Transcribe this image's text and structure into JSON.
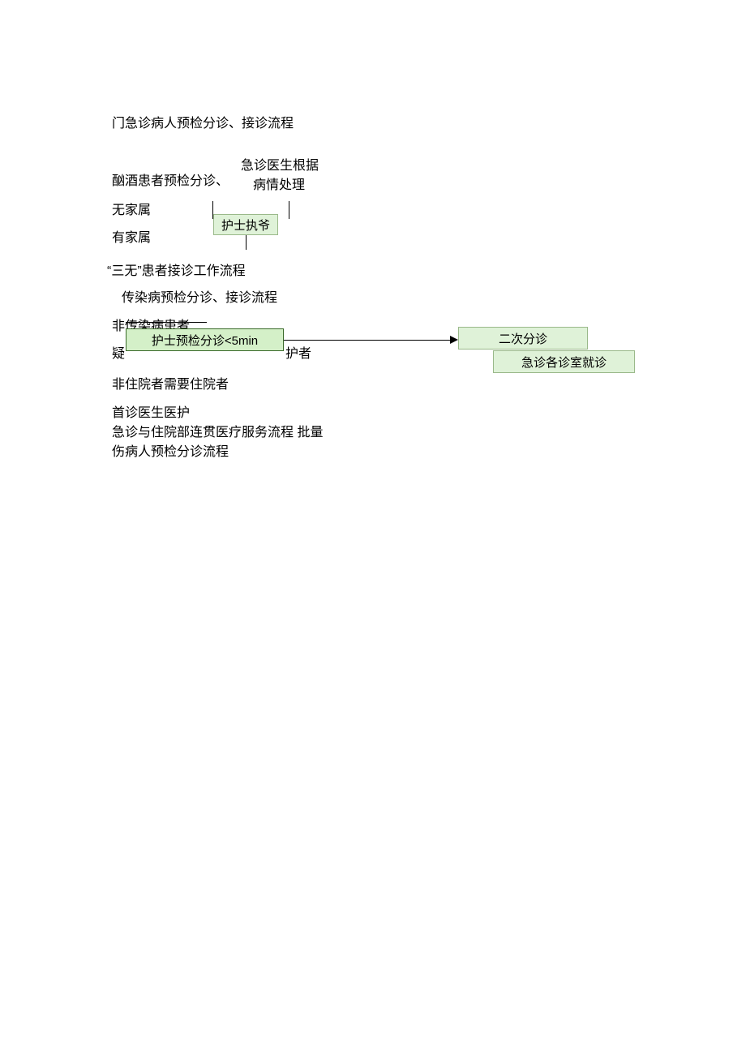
{
  "title": "门急诊病人预检分诊、接诊流程",
  "doctor_note_line1": "急诊医生根据",
  "doctor_note_line2": "病情处理",
  "drunk_patient": "酗酒患者预检分诊、",
  "no_family": "无家属",
  "has_family": "有家属",
  "nurse_exec": "护士执爷",
  "three_no": "“三无”患者接诊工作流程",
  "infectious": "传染病预检分诊、接诊流程",
  "non_infectious": "非传染病患者",
  "box_nurse_triage": "护士预检分诊<5min",
  "suspected_partial": "疑",
  "suspected_suffix": "护者",
  "box_second_triage": "二次分诊",
  "box_emergency_rooms": "急诊各诊室就诊",
  "non_inpatient": "非住院者需要住院者",
  "first_doctor": "首诊医生医护",
  "continuous_service": "急诊与住院部连贯医疗服务流程  批量",
  "mass_casualty": "伤病人预检分诊流程"
}
